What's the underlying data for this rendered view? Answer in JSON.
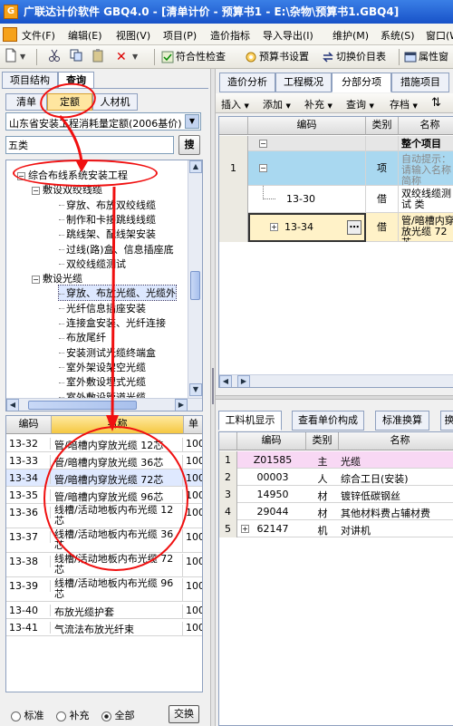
{
  "window": {
    "title": "广联达计价软件 GBQ4.0 - [清单计价 - 预算书1 - E:\\杂物\\预算书1.GBQ4]",
    "app_icon_letter": "G"
  },
  "menu": [
    "文件(F)",
    "编辑(E)",
    "视图(V)",
    "项目(P)",
    "造价指标",
    "导入导出(I)",
    "维护(M)",
    "系统(S)",
    "窗口(W)"
  ],
  "toolbar": {
    "check": "符合性检查",
    "budget_settings": "预算书设置",
    "switch_table": "切换价目表",
    "properties": "属性窗"
  },
  "left": {
    "top_tabs": [
      "项目结构",
      "查询"
    ],
    "sub_tabs": [
      "清单",
      "定额",
      "人材机"
    ],
    "quota_select": "山东省安装工程消耗量定额(2006基价)",
    "search_value": "五类",
    "search_button": "搜",
    "tree": [
      {
        "label": "综合布线系统安装工程",
        "level": 0,
        "exp": "−"
      },
      {
        "label": "敷设双绞线缆",
        "level": 1,
        "exp": "−"
      },
      {
        "label": "穿放、布放双绞线缆",
        "level": 2
      },
      {
        "label": "制作和卡接跳线线缆",
        "level": 2
      },
      {
        "label": "跳线架、配线架安装",
        "level": 2
      },
      {
        "label": "过线(路)盒、信息插座底",
        "level": 2
      },
      {
        "label": "双绞线缆测试",
        "level": 2
      },
      {
        "label": "敷设光缆",
        "level": 1,
        "exp": "−"
      },
      {
        "label": "穿放、布放光缆、光缆外",
        "level": 2,
        "selected": true
      },
      {
        "label": "光纤信息插座安装",
        "level": 2
      },
      {
        "label": "连接盒安装、光纤连接",
        "level": 2
      },
      {
        "label": "布放尾纤",
        "level": 2
      },
      {
        "label": "安装测试光缆终端盒",
        "level": 2
      },
      {
        "label": "室外架设架空光缆",
        "level": 2
      },
      {
        "label": "室外敷设埋式光缆",
        "level": 2
      },
      {
        "label": "室外敷设管道光缆",
        "level": 2
      }
    ],
    "grid": {
      "headers": [
        "编码",
        "名称",
        "单"
      ],
      "rows": [
        {
          "code": "13-32",
          "name": "管/暗槽内穿放光缆 12芯",
          "unit": "100"
        },
        {
          "code": "13-33",
          "name": "管/暗槽内穿放光缆 36芯",
          "unit": "100"
        },
        {
          "code": "13-34",
          "name": "管/暗槽内穿放光缆 72芯",
          "unit": "100",
          "selected": true
        },
        {
          "code": "13-35",
          "name": "管/暗槽内穿放光缆 96芯",
          "unit": "100"
        },
        {
          "code": "13-36",
          "name": "线槽/活动地板内布光缆 12芯",
          "unit": "100",
          "tall": true
        },
        {
          "code": "13-37",
          "name": "线槽/活动地板内布光缆 36芯",
          "unit": "100",
          "tall": true
        },
        {
          "code": "13-38",
          "name": "线槽/活动地板内布光缆 72芯",
          "unit": "100",
          "tall": true
        },
        {
          "code": "13-39",
          "name": "线槽/活动地板内布光缆 96芯",
          "unit": "100",
          "tall": true
        },
        {
          "code": "13-40",
          "name": "布放光缆护套",
          "unit": "100"
        },
        {
          "code": "13-41",
          "name": "气流法布放光纤束",
          "unit": "100"
        }
      ]
    },
    "filters": [
      "标准",
      "补充",
      "全部"
    ],
    "filter_selected": "全部",
    "swap_button": "交换"
  },
  "right": {
    "tabs": [
      "造价分析",
      "工程概况",
      "分部分项",
      "措施项目"
    ],
    "active_tab": "分部分项",
    "subtoolbar": [
      "插入",
      "添加",
      "补充",
      "查询",
      "存档"
    ],
    "grid_headers": [
      "编码",
      "类别",
      "名称"
    ],
    "rows": [
      {
        "index": "",
        "code": "",
        "type": "",
        "name": "整个项目",
        "exp": "−"
      },
      {
        "index": "1",
        "code": "",
        "type": "项",
        "name": "自动提示：请输入名称简称",
        "exp": "−",
        "hint": true
      },
      {
        "index": "",
        "code": "13-30",
        "type": "借",
        "name": "双绞线缆测试 类"
      },
      {
        "index": "",
        "code": "13-34",
        "type": "借",
        "name": "管/暗槽内穿放光缆 72芯",
        "exp": "+",
        "editing": true
      }
    ],
    "bottom_tabs": [
      "工料机显示",
      "查看单价构成",
      "标准换算",
      "换"
    ],
    "bottom_headers": [
      "编码",
      "类别",
      "名称"
    ],
    "bottom_rows": [
      {
        "index": "1",
        "code": "Z01585",
        "type": "主",
        "name": "光缆",
        "highlight": true
      },
      {
        "index": "2",
        "code": "00003",
        "type": "人",
        "name": "综合工日(安装)"
      },
      {
        "index": "3",
        "code": "14950",
        "type": "材",
        "name": "镀锌低碳钢丝"
      },
      {
        "index": "4",
        "code": "29044",
        "type": "材",
        "name": "其他材料费占辅材费"
      },
      {
        "index": "5",
        "code": "62147",
        "type": "机",
        "name": "对讲机",
        "exp": "+"
      }
    ]
  }
}
